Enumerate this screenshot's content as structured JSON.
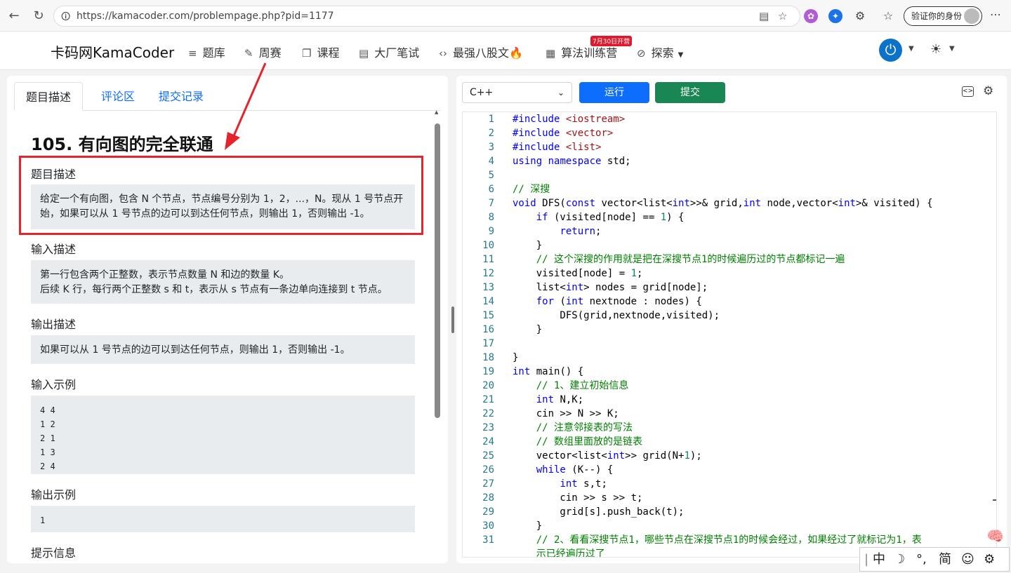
{
  "browser": {
    "url": "https://kamacoder.com/problempage.php?pid=1177",
    "verify_label": "验证你的身份"
  },
  "site": {
    "brand": "卡码网KamaCoder",
    "nav": [
      "题库",
      "周赛",
      "课程",
      "大厂笔试",
      "最强八股文",
      "算法训练营",
      "探索"
    ],
    "badge": "7月30日开营"
  },
  "left": {
    "tabs": [
      "题目描述",
      "评论区",
      "提交记录"
    ],
    "title": "105. 有向图的完全联通",
    "sections": [
      {
        "heading": "题目描述",
        "text": "给定一个有向图，包含 N 个节点，节点编号分别为 1，2，...，N。现从 1 号节点开始，如果可以从 1 号节点的边可以到达任何节点，则输出 1，否则输出 -1。"
      },
      {
        "heading": "输入描述",
        "text": "第一行包含两个正整数，表示节点数量 N 和边的数量 K。\n后续 K 行，每行两个正整数 s 和 t，表示从 s 节点有一条边单向连接到 t 节点。"
      },
      {
        "heading": "输出描述",
        "text": "如果可以从 1 号节点的边可以到达任何节点，则输出 1，否则输出 -1。"
      },
      {
        "heading": "输入示例",
        "text": "4 4\n1 2\n2 1\n1 3\n2 4"
      },
      {
        "heading": "输出示例",
        "text": "1"
      },
      {
        "heading": "提示信息",
        "text": ""
      }
    ]
  },
  "editor": {
    "language": "C++",
    "run_label": "运行",
    "submit_label": "提交",
    "lines": [
      "#include <iostream>",
      "#include <vector>",
      "#include <list>",
      "using namespace std;",
      "",
      "// 深搜",
      "void DFS(const vector<list<int>>& grid,int node,vector<int>& visited) {",
      "    if (visited[node] == 1) {",
      "        return;",
      "    }",
      "    // 这个深搜的作用就是把在深搜节点1的时候遍历过的节点都标记一遍",
      "    visited[node] = 1;",
      "    list<int> nodes = grid[node];",
      "    for (int nextnode : nodes) {",
      "        DFS(grid,nextnode,visited);",
      "    }",
      "",
      "}",
      "int main() {",
      "    // 1、建立初始信息",
      "    int N,K;",
      "    cin >> N >> K;",
      "    // 注意邻接表的写法",
      "    // 数组里面放的是链表",
      "    vector<list<int>> grid(N+1);",
      "    while (K--) {",
      "        int s,t;",
      "        cin >> s >> t;",
      "        grid[s].push_back(t);",
      "    }",
      "    // 2、看看深搜节点1，哪些节点在深搜节点1的时候会经过，如果经过了就标记为1，表",
      "    示已经遍历过了"
    ],
    "line_numbers": [
      "1",
      "2",
      "3",
      "4",
      "5",
      "6",
      "7",
      "8",
      "9",
      "10",
      "11",
      "12",
      "13",
      "14",
      "15",
      "16",
      "17",
      "18",
      "19",
      "20",
      "21",
      "22",
      "23",
      "24",
      "25",
      "26",
      "27",
      "28",
      "29",
      "30",
      "31",
      ""
    ]
  },
  "ime": {
    "items": [
      "中",
      "☽",
      "°,",
      "简",
      "☺",
      "⚙"
    ]
  },
  "colors": {
    "primary": "#0d6efd",
    "success": "#198754",
    "annotation": "#e4252b"
  }
}
